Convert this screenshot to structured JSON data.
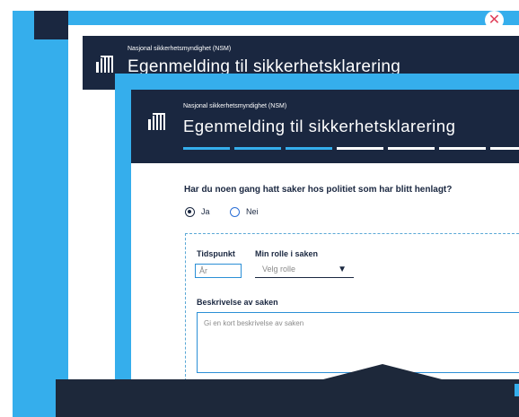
{
  "close_icon": "close-icon",
  "back_window": {
    "agency": "Nasjonal sikkerhetsmyndighet (NSM)",
    "title": "Egenmelding til sikkerhetsklarering"
  },
  "front_window": {
    "agency": "Nasjonal sikkerhetsmyndighet (NSM)",
    "title": "Egenmelding til sikkerhetsklarering",
    "progress": {
      "total_steps": 7,
      "completed_steps": 3
    }
  },
  "form": {
    "question": "Har du noen gang hatt saker hos politiet som har blitt henlagt?",
    "options": [
      {
        "label": "Ja",
        "selected": true
      },
      {
        "label": "Nei",
        "selected": false
      }
    ],
    "time_label": "Tidspunkt",
    "year_placeholder": "År",
    "role_label": "Min rolle i saken",
    "role_placeholder": "Velg rolle",
    "description_label": "Beskrivelse av saken",
    "description_placeholder": "Gi en kort beskrivelse av saken"
  },
  "colors": {
    "navy": "#1a2740",
    "accent_blue": "#35aeec",
    "close_red": "#e0405a"
  }
}
